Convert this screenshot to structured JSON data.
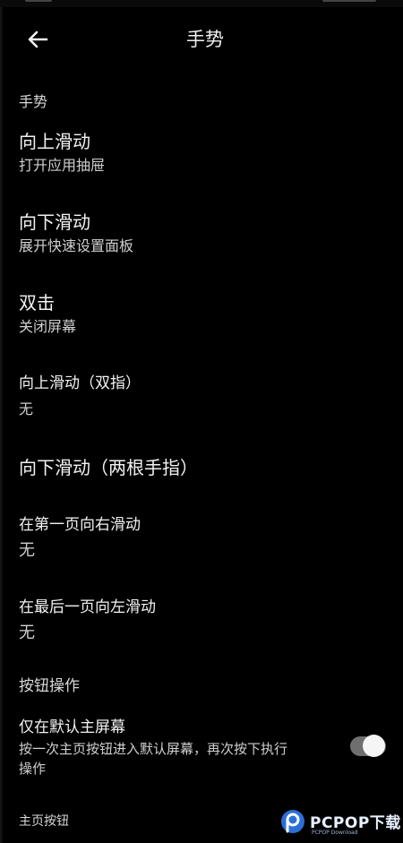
{
  "header": {
    "title": "手势",
    "back_icon": "arrow-left-icon"
  },
  "gestures_section": {
    "label": "手势",
    "items": [
      {
        "title": "向上滑动",
        "subtitle": "打开应用抽屉"
      },
      {
        "title": "向下滑动",
        "subtitle": "展开快速设置面板"
      },
      {
        "title": "双击",
        "subtitle": "关闭屏幕"
      },
      {
        "title": "向上滑动（双指）",
        "subtitle": "无"
      },
      {
        "title": "向下滑动（两根手指）",
        "subtitle": ""
      },
      {
        "title": "在第一页向右滑动",
        "subtitle": "无"
      },
      {
        "title": "在最后一页向左滑动",
        "subtitle": "无"
      }
    ]
  },
  "buttons_section": {
    "label": "按钮操作",
    "default_home_only": {
      "title": "仅在默认主屏幕",
      "description": "按一次主页按钮进入默认屏幕，再次按下执行操作",
      "toggle_on": true
    }
  },
  "footer": {
    "label": "主页按钮"
  },
  "watermark": {
    "text": "PCPOP下载",
    "sub": "PCPOP Download"
  },
  "colors": {
    "background": "#000000",
    "text": "#f2f2f2",
    "toggle_track": "#6f6f6f",
    "toggle_knob": "#f5f5f5"
  }
}
